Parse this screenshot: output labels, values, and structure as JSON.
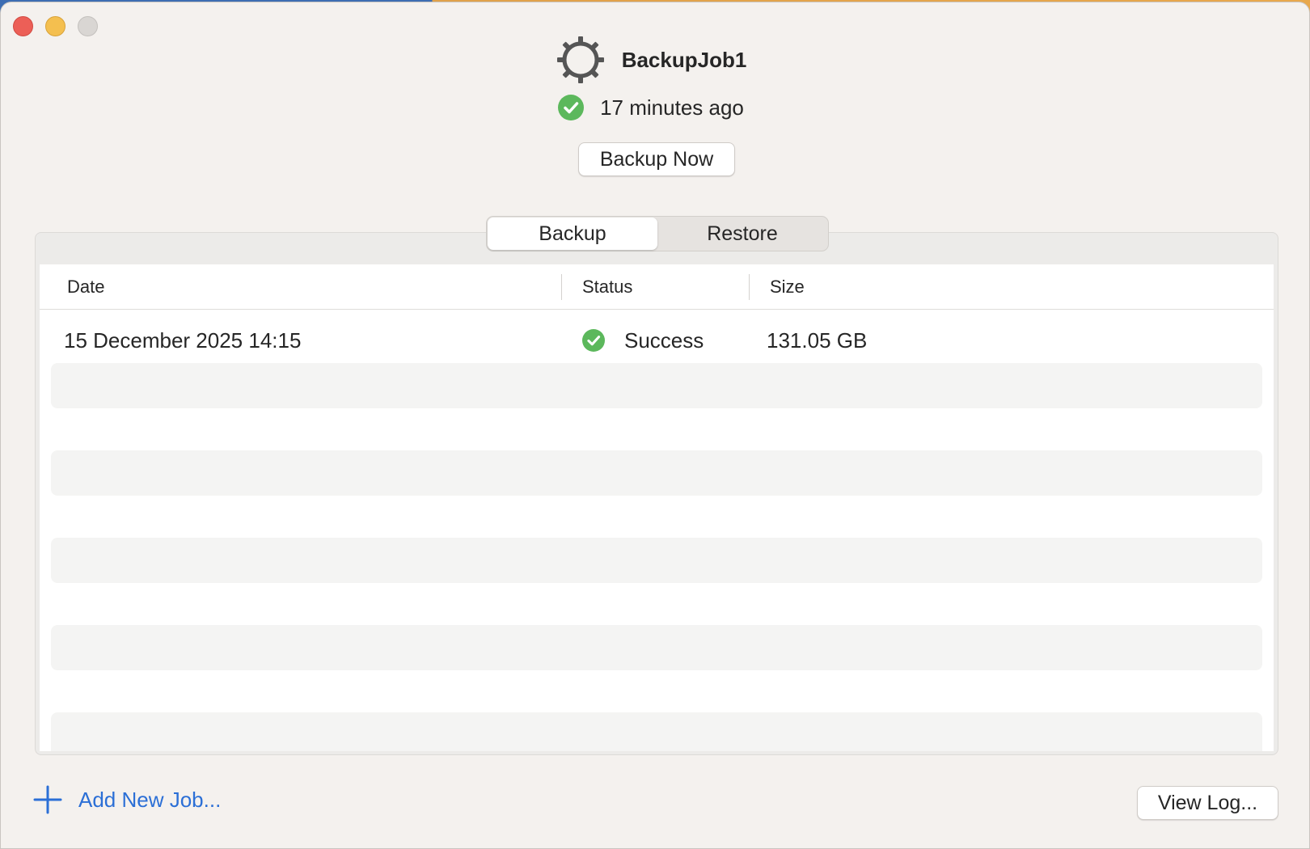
{
  "window": {
    "title_job": "BackupJob1",
    "last_run": "17 minutes ago",
    "backup_now_label": "Backup Now"
  },
  "tabs": [
    {
      "label": "Backup",
      "active": true
    },
    {
      "label": "Restore",
      "active": false
    }
  ],
  "table": {
    "columns": [
      "Date",
      "Status",
      "Size"
    ],
    "rows": [
      {
        "date": "15 December 2025 14:15",
        "status": "Success",
        "size": "131.05 GB"
      }
    ]
  },
  "footer": {
    "add_job_label": "Add New Job...",
    "view_log_label": "View Log..."
  },
  "colors": {
    "accent": "#2b6fd6",
    "success": "#5cb85c",
    "window_bg": "#f4f1ee"
  },
  "icons": {
    "job": "gear-icon",
    "status": "check-circle-icon",
    "add": "plus-icon"
  }
}
